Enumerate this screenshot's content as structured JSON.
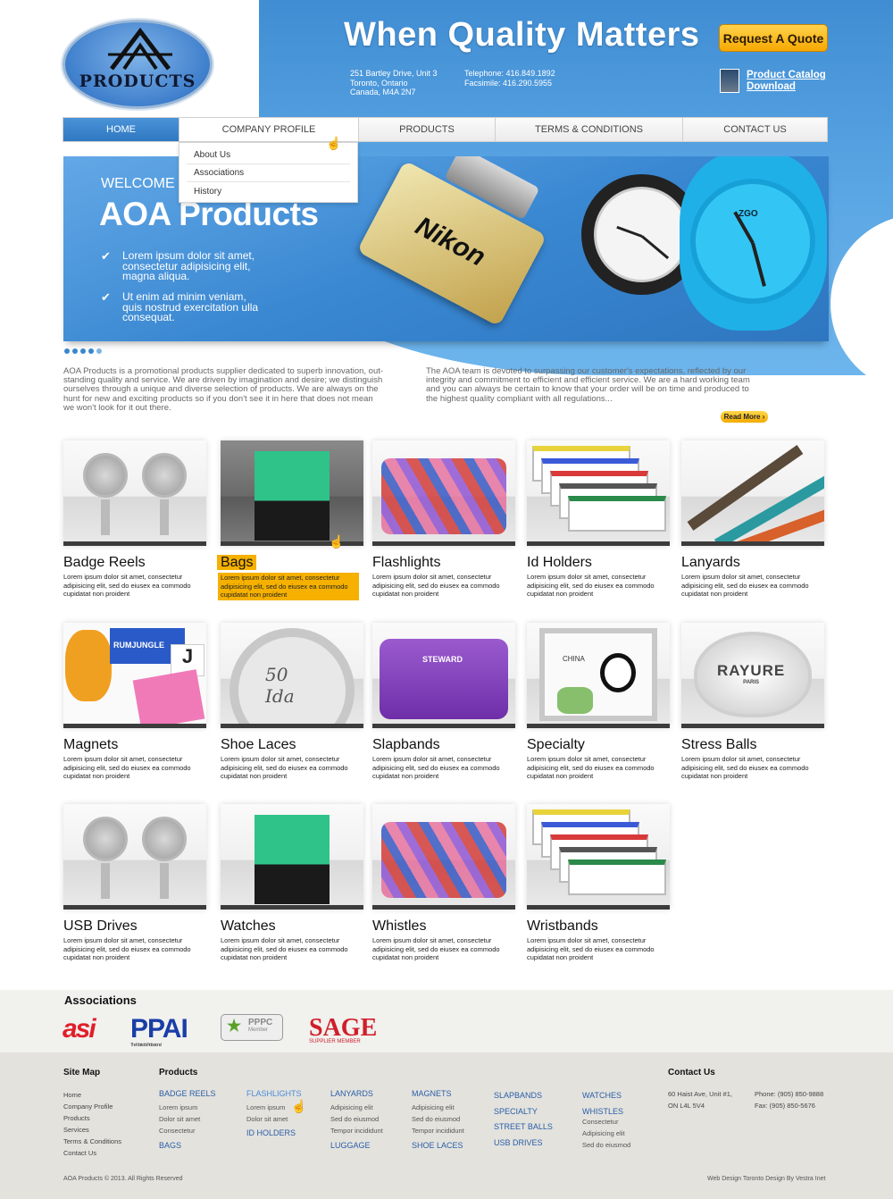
{
  "colors": {
    "brand_blue": "#3a88d2",
    "accent_orange": "#f6a800",
    "footer_bg": "#e3e2dd",
    "link_blue": "#2a5ea8"
  },
  "header": {
    "logo_text": "PRODUCTS",
    "tagline": "When Quality Matters",
    "quote_button": "Request A Quote",
    "address": [
      "251 Bartley Drive, Unit 3",
      "Toronto, Ontario",
      "Canada, M4A 2N7"
    ],
    "phone": [
      "Telephone: 416.849.1892",
      "Facsimile: 416.290.5955"
    ],
    "catalog_link": [
      "Product Catalog",
      "Download"
    ]
  },
  "nav": {
    "items": [
      "HOME",
      "COMPANY PROFILE",
      "PRODUCTS",
      "TERMS & CONDITIONS",
      "CONTACT US"
    ],
    "dropdown": [
      "About Us",
      "Associations",
      "History"
    ]
  },
  "banner": {
    "welcome": "WELCOME T",
    "title": "AOA Products",
    "bullets": [
      [
        "Lorem ipsum dolor sit amet,",
        "consectetur adipisicing elit,",
        "magna aliqua."
      ],
      [
        "Ut enim ad minim veniam,",
        "quis nostrud exercitation ulla",
        "consequat."
      ]
    ],
    "usb_brand": "Nikon",
    "watch_brand": "ZGO"
  },
  "intro": {
    "left": [
      "AOA Products is a promotional products supplier dedicated to superb innovation, out-",
      "standing quality and service.  We are driven by imagination and desire; we distinguish",
      "ourselves through a unique and diverse selection of products.  We are always on the",
      "hunt for new and exciting products so if you don't see it in here that does not mean",
      "we won't look for it out there."
    ],
    "right": [
      "The AOA team is devoted to surpassing our customer's expectations, reflected by our",
      "integrity and commitment to efficient and efficient service.  We are a hard working team",
      "and you can always be certain to know that your order will be on time and produced to",
      "the highest quality compliant with all regulations..."
    ],
    "read_more": "Read More"
  },
  "products": [
    {
      "name": "Badge Reels",
      "desc": [
        "Lorem ipsum dolor sit amet, consectetur",
        "adipisicing elit, sed do eiusex ea commodo",
        "cupidatat non proident"
      ]
    },
    {
      "name": "Bags",
      "desc": [
        "Lorem ipsum dolor sit amet, consectetur",
        "adipisicing elit, sed do eiusex ea commodo",
        "cupidatat non proident"
      ]
    },
    {
      "name": "Flashlights",
      "desc": [
        "Lorem ipsum dolor sit amet, consectetur",
        "adipisicing elit, sed do eiusex ea commodo",
        "cupidatat non proident"
      ]
    },
    {
      "name": "Id Holders",
      "desc": [
        "Lorem ipsum dolor sit amet, consectetur",
        "adipisicing elit, sed do eiusex ea commodo",
        "cupidatat non proident"
      ]
    },
    {
      "name": "Lanyards",
      "desc": [
        "Lorem ipsum dolor sit amet, consectetur",
        "adipisicing elit, sed do eiusex ea commodo",
        "cupidatat non proident"
      ]
    },
    {
      "name": "Magnets",
      "desc": [
        "Lorem ipsum dolor sit amet, consectetur",
        "adipisicing elit, sed do eiusex ea commodo",
        "cupidatat non proident"
      ]
    },
    {
      "name": "Shoe Laces",
      "desc": [
        "Lorem ipsum dolor sit amet, consectetur",
        "adipisicing elit, sed do eiusex ea commodo",
        "cupidatat non proident"
      ]
    },
    {
      "name": "Slapbands",
      "desc": [
        "Lorem ipsum dolor sit amet, consectetur",
        "adipisicing elit, sed do eiusex ea commodo",
        "cupidatat non proident"
      ]
    },
    {
      "name": "Specialty",
      "desc": [
        "Lorem ipsum dolor sit amet, consectetur",
        "adipisicing elit, sed do eiusex ea commodo",
        "cupidatat non proident"
      ]
    },
    {
      "name": "Stress Balls",
      "desc": [
        "Lorem ipsum dolor sit amet, consectetur",
        "adipisicing elit, sed do eiusex ea commodo",
        "cupidatat non proident"
      ]
    },
    {
      "name": "USB Drives",
      "desc": [
        "Lorem ipsum dolor sit amet, consectetur",
        "adipisicing elit, sed do eiusex ea commodo",
        "cupidatat non proident"
      ]
    },
    {
      "name": "Watches",
      "desc": [
        "Lorem ipsum dolor sit amet, consectetur",
        "adipisicing elit, sed do eiusex ea commodo",
        "cupidatat non proident"
      ]
    },
    {
      "name": "Whistles",
      "desc": [
        "Lorem ipsum dolor sit amet, consectetur",
        "adipisicing elit, sed do eiusex ea commodo",
        "cupidatat non proident"
      ]
    },
    {
      "name": "Wristbands",
      "desc": [
        "Lorem ipsum dolor sit amet, consectetur",
        "adipisicing elit, sed do eiusex ea commodo",
        "cupidatat non proident"
      ]
    }
  ],
  "product_art": {
    "magnets": [
      "RUMJUNGLE",
      "J",
      "LO",
      "VE"
    ],
    "shoe_laces": [
      "50",
      "Ida"
    ],
    "slapbands": "STEWARD",
    "specialty": "CHINA",
    "stress_balls": [
      "RAYURE",
      "PARIS"
    ],
    "lanyards": [
      "LEXUS",
      "LEXUS",
      "Mcdonald"
    ]
  },
  "associations": {
    "title": "Associations",
    "logos": [
      "asi",
      "PPAI",
      "PPPC",
      "SAGE"
    ],
    "taglines": [
      "The Mark of a Professional",
      "Member",
      "SUPPLIER MEMBER"
    ]
  },
  "footer": {
    "sitemap_title": "Site Map",
    "sitemap": [
      "Home",
      "Company Profile",
      "Products",
      "Services",
      "Terms & Conditions",
      "Contact Us"
    ],
    "products_title": "Products",
    "col1": {
      "cat": "BADGE REELS",
      "subs": [
        "Lorem ipsum",
        "Dolor sit amet",
        "Consectetur"
      ],
      "cat2": "BAGS"
    },
    "col2": {
      "cat": "FLASHLIGHTS",
      "subs": [
        "Lorem ipsum",
        "Dolor sit amet"
      ],
      "cat2": "ID HOLDERS"
    },
    "col3": {
      "cat": "LANYARDS",
      "subs": [
        "Adipisicing elit",
        "Sed do eiusmod",
        "Tempor incididunt"
      ],
      "cat2": "LUGGAGE"
    },
    "col4": {
      "cat": "MAGNETS",
      "subs": [
        "Adipisicing elit",
        "Sed do eiusmod",
        "Tempor incididunt"
      ],
      "cat2": "SHOE LACES"
    },
    "col5": {
      "cats": [
        "SLAPBANDS",
        "SPECIALTY",
        "STREET BALLS",
        "USB DRIVES"
      ]
    },
    "col6": {
      "cats": [
        "WATCHES",
        "WHISTLES"
      ],
      "subs": [
        "Consectetur",
        "Adipisicing elit",
        "Sed do eiusmod"
      ]
    },
    "contact_title": "Contact Us",
    "contact_addr": [
      "60 Haist Ave, Unit #1,",
      "ON L4L 5V4"
    ],
    "contact_phone": [
      "Phone: (905) 850-9888",
      "Fax: (905) 850-5676"
    ],
    "copyright": "AOA Products © 2013. All Rights Reserved",
    "credit": "Web Design Toronto Design By Vestra Inet"
  }
}
